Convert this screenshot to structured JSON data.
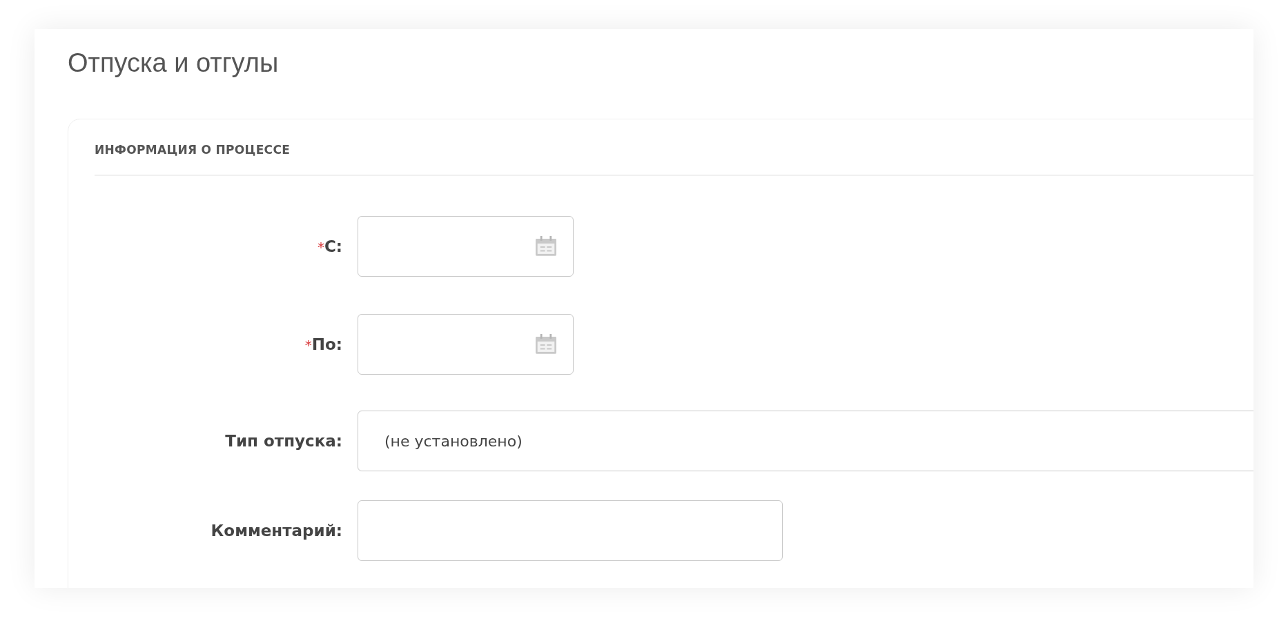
{
  "page": {
    "title": "Отпуска и отгулы"
  },
  "section": {
    "title": "ИНФОРМАЦИЯ О ПРОЦЕССЕ"
  },
  "fields": [
    {
      "kind": "date",
      "asterisk": "*",
      "label": "С:"
    },
    {
      "kind": "date",
      "asterisk": "*",
      "label": "По:"
    },
    {
      "kind": "select",
      "label": "Тип отпуска:",
      "value": "(не установлено)"
    },
    {
      "kind": "text",
      "label": "Комментарий:"
    }
  ]
}
